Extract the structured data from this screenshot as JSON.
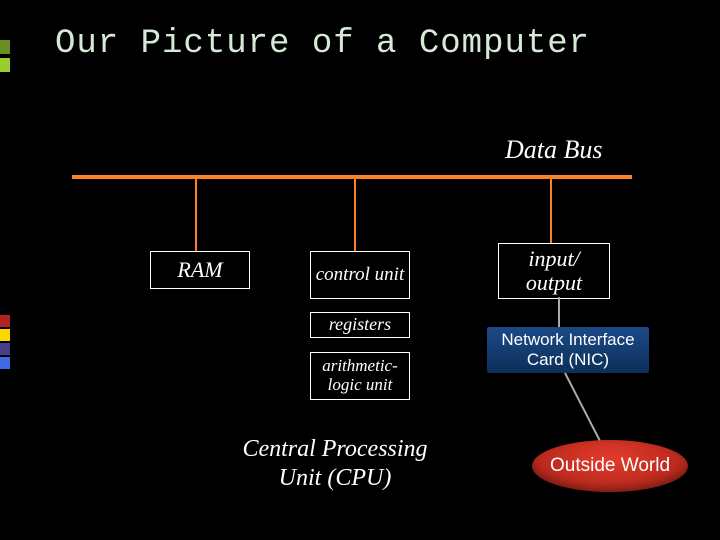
{
  "title": "Our Picture of a Computer",
  "bus_label": "Data Bus",
  "boxes": {
    "ram": "RAM",
    "control": "control unit",
    "registers": "registers",
    "alu": "arithmetic-logic unit",
    "io": "input/ output",
    "nic": "Network Interface Card (NIC)"
  },
  "cpu_label": "Central Processing Unit (CPU)",
  "outside_world": "Outside World",
  "colors": {
    "bus": "#ff7f27",
    "nic_bg": "#1b4a87",
    "oval_bg": "#e33b2b",
    "title_text": "#d6e9d6"
  },
  "stripe_colors": [
    "#6b8e23",
    "#9acd32",
    "#b22222",
    "#ffd700",
    "#483d8b",
    "#4169e1"
  ]
}
